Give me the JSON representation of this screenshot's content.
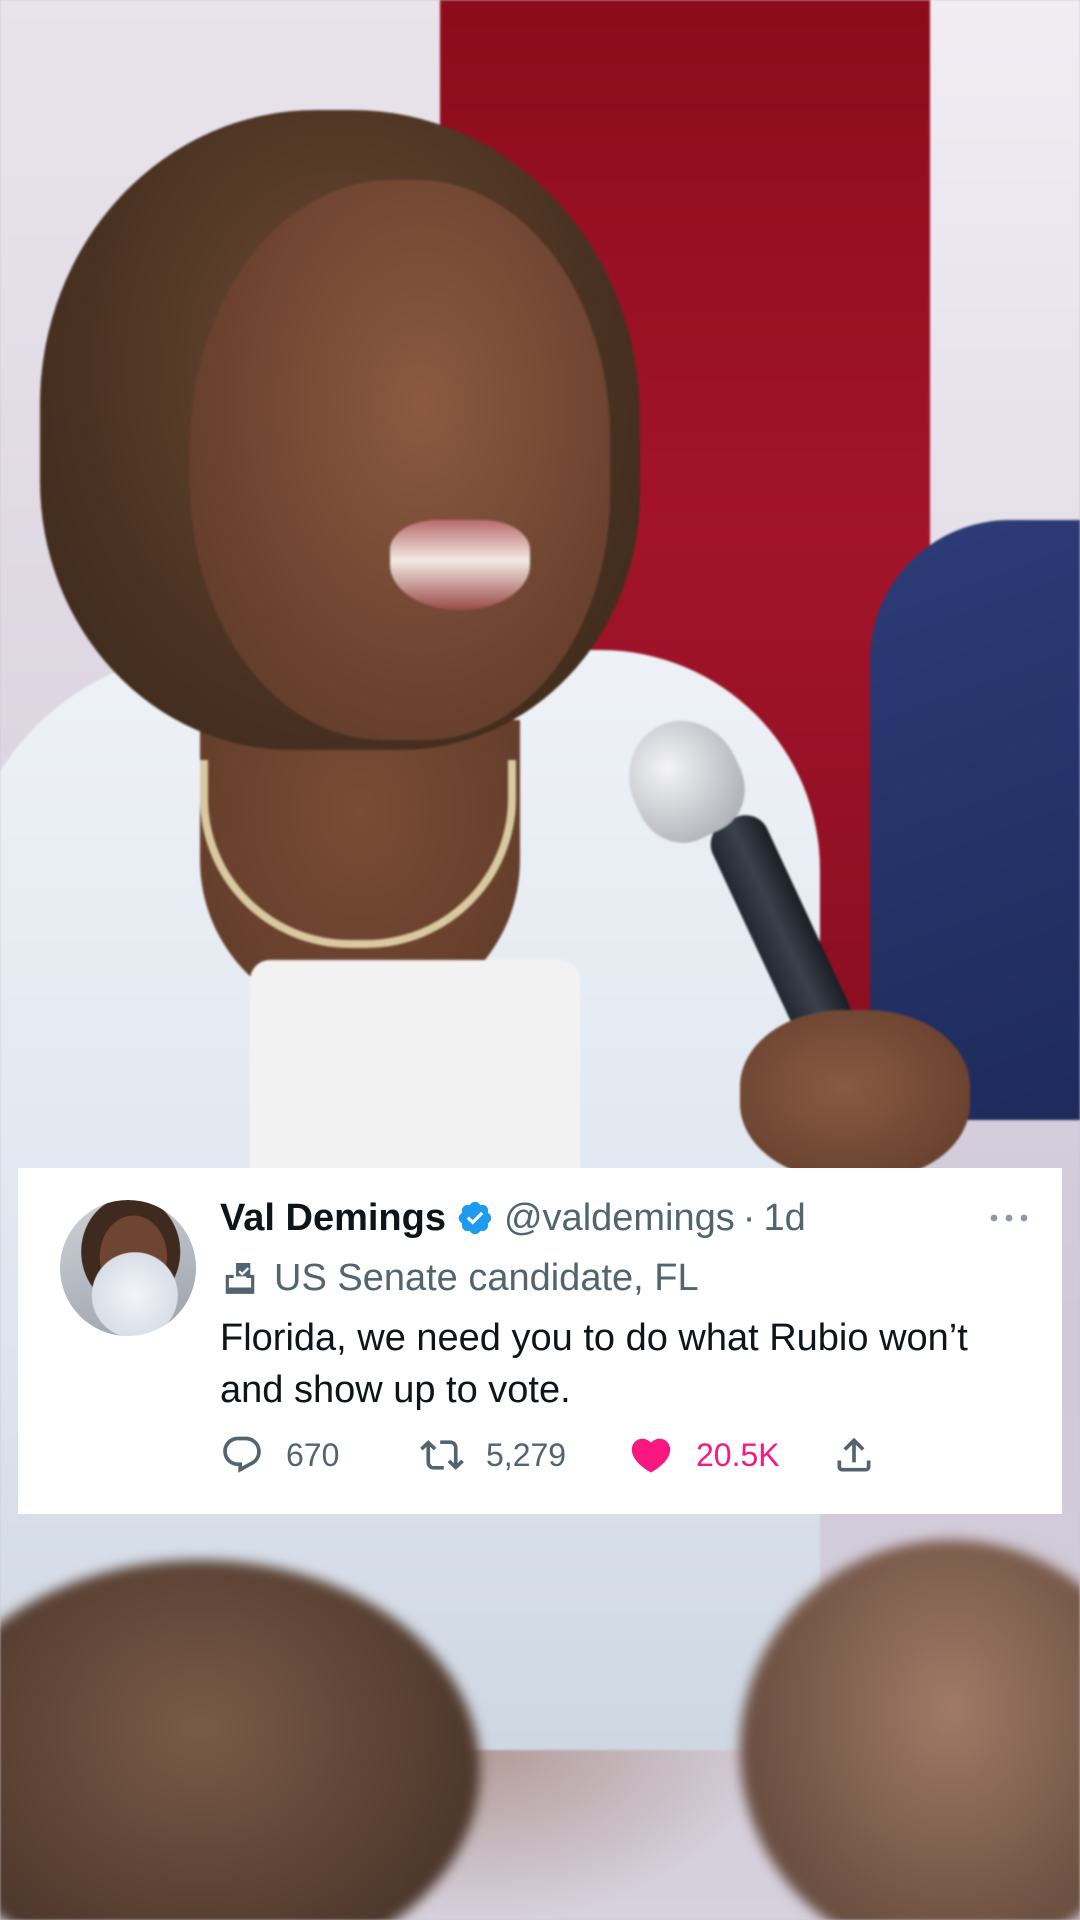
{
  "tweet": {
    "display_name": "Val Demings",
    "handle": "@valdemings",
    "separator": "·",
    "timestamp": "1d",
    "label": "US Senate candidate, FL",
    "text": "Florida, we need you to do what Rubio won’t and show up to vote.",
    "replies": "670",
    "retweets": "5,279",
    "likes": "20.5K",
    "liked": true
  },
  "colors": {
    "verified": "#1d9bf0",
    "like": "#f91880",
    "secondary_text": "#536471",
    "primary_text": "#0f1419",
    "card_background": "#ffffff"
  },
  "icons": {
    "verified": "verified-badge-icon",
    "label": "ballot-box-icon",
    "more": "more-options-icon",
    "reply": "reply-icon",
    "retweet": "retweet-icon",
    "like": "heart-icon",
    "share": "share-icon"
  }
}
